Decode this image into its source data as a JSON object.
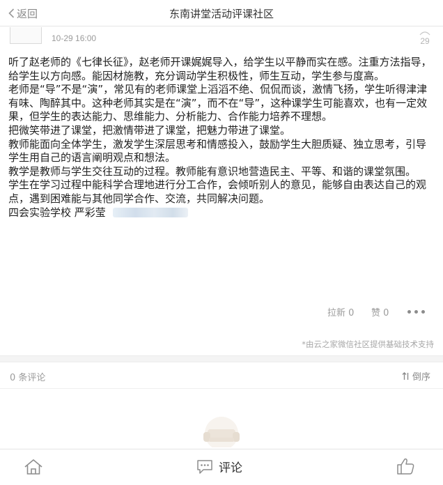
{
  "header": {
    "back_label": "返回",
    "title": "东南讲堂活动评课社区"
  },
  "post": {
    "time": "10-29 16:00",
    "floor": "29",
    "paragraphs": [
      "听了赵老师的《七律长征》，赵老师开课娓娓导入，给学生以平静而实在感。注重方法指导，给学生以方向感。能因材施教，充分调动学生积极性，师生互动，学生参与度高。",
      "老师是“导”不是“演”，常见有的老师课堂上滔滔不绝、侃侃而谈，激情飞扬，学生听得津津有味、陶醉其中。这种老师其实是在“演”，而不在“导”，这种课学生可能喜欢，也有一定效果，但学生的表达能力、思维能力、分析能力、合作能力培养不理想。",
      "把微笑带进了课堂，把激情带进了课堂，把魅力带进了课堂。",
      "教师能面向全体学生，激发学生深层思考和情感投入，鼓励学生大胆质疑、独立思考，引导学生用自己的语言阐明观点和想法。",
      "教学是教师与学生交往互动的过程。教师能有意识地营造民主、平等、和谐的课堂氛围。",
      "学生在学习过程中能科学合理地进行分工合作，会倾听别人的意见，能够自由表达自己的观点，遇到困难能与其他同学合作、交流，共同解决问题。"
    ],
    "signature": "四会实验学校  严彩莹"
  },
  "actions": {
    "oppose_label": "拉新",
    "oppose_count": "0",
    "like_label": "赞",
    "like_count": "0"
  },
  "powered_by": "*由云之家微信社区提供基础技术支持",
  "comments": {
    "count_label": "0 条评论",
    "sort_label": "倒序"
  },
  "bottom_bar": {
    "comment_label": "评论"
  },
  "colors": {
    "text": "#222222",
    "muted": "#9b9b9b",
    "divider": "#f4f4f4"
  },
  "icons": [
    "chevron-left-icon",
    "floor-icon",
    "more-icon",
    "sort-icon",
    "empty-sofa-icon",
    "home-icon",
    "comment-icon",
    "thumbs-up-icon"
  ]
}
